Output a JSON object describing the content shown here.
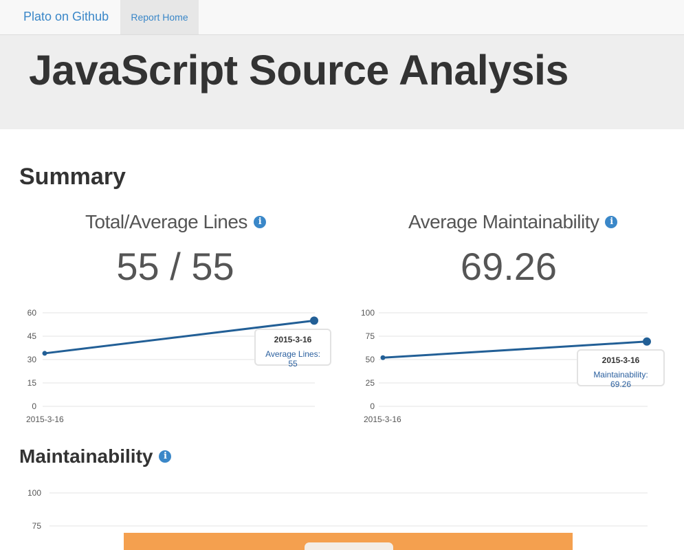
{
  "navbar": {
    "brand": "Plato on Github",
    "link": "Report Home"
  },
  "header": {
    "title": "JavaScript Source Analysis"
  },
  "summary": {
    "heading": "Summary",
    "lines": {
      "title": "Total/Average Lines",
      "value": "55 / 55"
    },
    "maintainability": {
      "title": "Average Maintainability",
      "value": "69.26"
    }
  },
  "maintainability_section": {
    "heading": "Maintainability"
  },
  "colors": {
    "line": "#225f96",
    "accent": "#3a87c8",
    "bar": "#f4a04f",
    "grid": "#e3e3e3"
  },
  "chart_data": [
    {
      "type": "line",
      "x": [
        "2015-3-16",
        "2015-3-16"
      ],
      "series": [
        {
          "values": [
            34,
            55
          ]
        }
      ],
      "ylim": [
        0,
        60
      ],
      "yticks": [
        "0",
        "15",
        "30",
        "45",
        "60"
      ],
      "tick_label": "2015-3-16",
      "tooltip": {
        "date": "2015-3-16",
        "text": "Average Lines: 55"
      }
    },
    {
      "type": "line",
      "x": [
        "2015-3-16",
        "2015-3-16"
      ],
      "series": [
        {
          "values": [
            52,
            69.26
          ]
        }
      ],
      "ylim": [
        0,
        100
      ],
      "yticks": [
        "0",
        "25",
        "50",
        "75",
        "100"
      ],
      "tick_label": "2015-3-16",
      "tooltip": {
        "date": "2015-3-16",
        "text": "Maintainability: 69.26"
      }
    },
    {
      "type": "bar",
      "ylim": [
        0,
        100
      ],
      "yticks": [
        "100",
        "75"
      ]
    }
  ]
}
